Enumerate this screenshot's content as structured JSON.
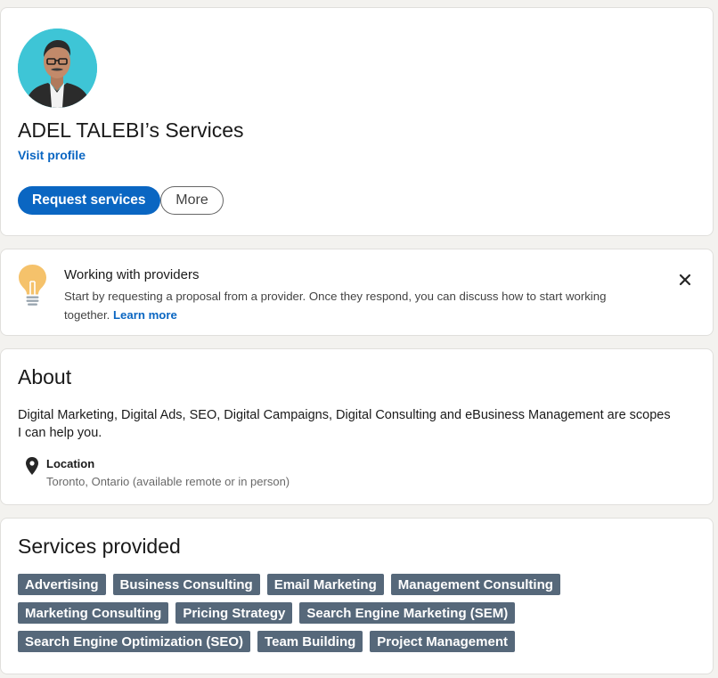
{
  "header": {
    "title": "ADEL TALEBI’s Services",
    "visit_profile": "Visit profile",
    "request_services": "Request services",
    "more": "More"
  },
  "info_banner": {
    "title": "Working with providers",
    "body": "Start by requesting a proposal from a provider. Once they respond, you can discuss how to start working together.",
    "learn_more": "Learn more"
  },
  "about": {
    "title": "About",
    "description": "Digital Marketing, Digital Ads, SEO, Digital Campaigns, Digital Consulting and eBusiness Management are scopes I can help you.",
    "location_label": "Location",
    "location_value": "Toronto, Ontario (available remote or in person)"
  },
  "services": {
    "title": "Services provided",
    "tags": [
      "Advertising",
      "Business Consulting",
      "Email Marketing",
      "Management Consulting",
      "Marketing Consulting",
      "Pricing Strategy",
      "Search Engine Marketing (SEM)",
      "Search Engine Optimization (SEO)",
      "Team Building",
      "Project Management"
    ]
  },
  "colors": {
    "primary": "#0a66c2",
    "tag_bg": "#56687a",
    "page_bg": "#f3f2ef",
    "avatar_bg": "#3ec5d6",
    "bulb": "#f5c26b"
  },
  "icons": {
    "avatar": "profile-photo",
    "bulb": "lightbulb-icon",
    "close": "close-icon",
    "location": "map-pin-icon"
  }
}
